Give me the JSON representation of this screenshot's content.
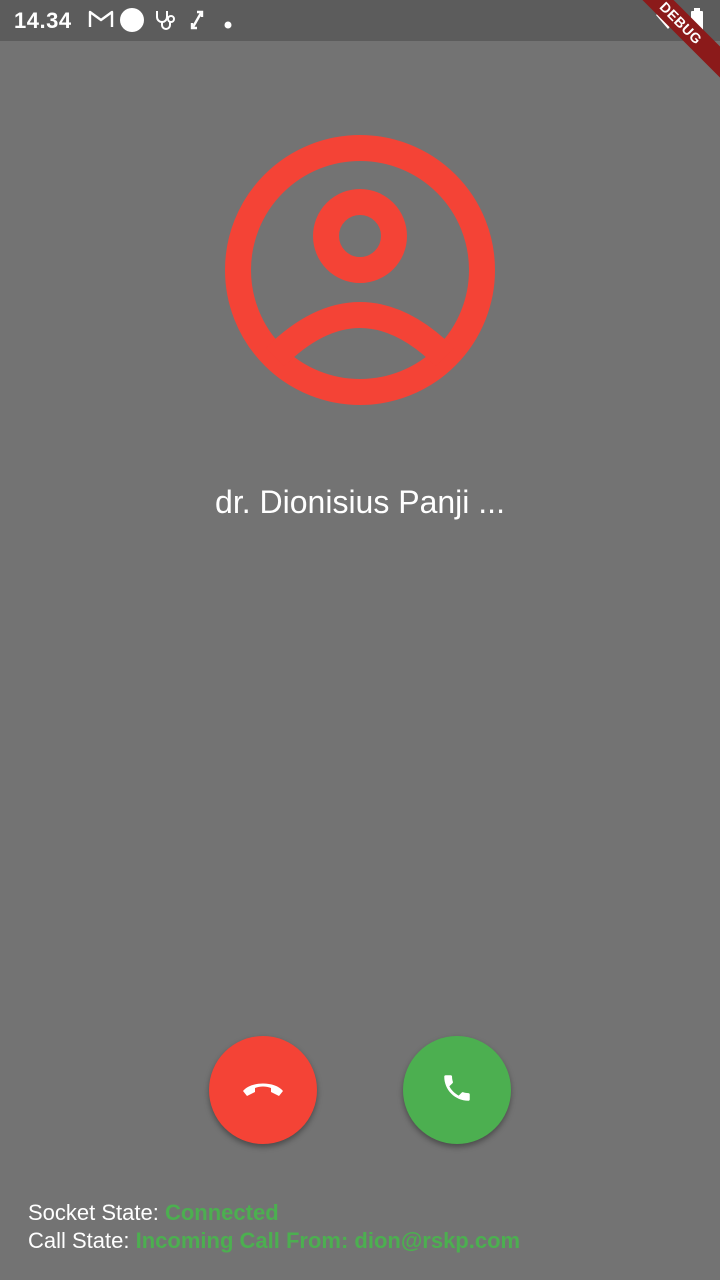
{
  "status_bar": {
    "time": "14.34",
    "icons": [
      "gmail-icon",
      "circle-icon",
      "stethoscope-icon",
      "sync-icon",
      "dot-icon",
      "wifi-icon",
      "battery-icon"
    ]
  },
  "debug_banner": "DEBUG",
  "caller": {
    "name": "dr. Dionisius Panji ..."
  },
  "buttons": {
    "decline_icon": "call-end-icon",
    "accept_icon": "phone-icon"
  },
  "states": {
    "socket_label": "Socket State: ",
    "socket_value": "Connected",
    "call_label": "Call State: ",
    "call_value": "Incoming Call From: dion@rskp.com"
  },
  "colors": {
    "background": "#737373",
    "decline": "#f44336",
    "accept": "#4caf50",
    "avatar": "#f44336",
    "state_value": "#4caf50"
  }
}
